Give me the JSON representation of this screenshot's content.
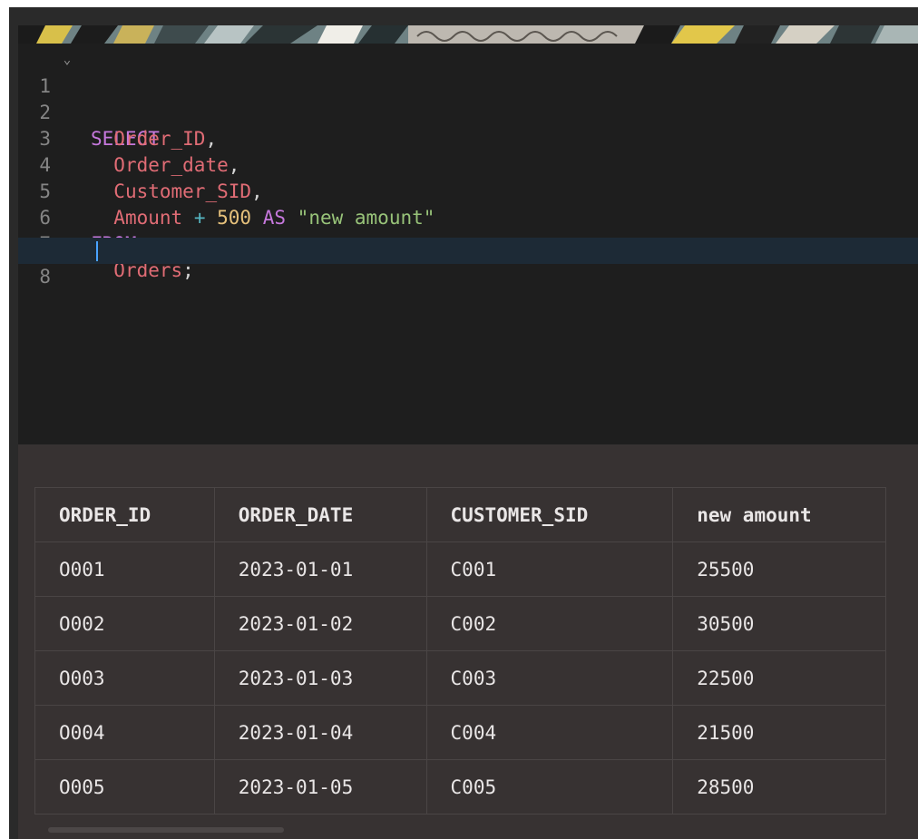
{
  "editor": {
    "line_numbers": [
      "1",
      "2",
      "3",
      "4",
      "5",
      "6",
      "7",
      "8"
    ],
    "fold_glyph": "⌄",
    "tokens": {
      "select": "SELECT",
      "order_id": "Order_ID",
      "order_date": "Order_date",
      "customer_sid": "Customer_SID",
      "amount": "Amount",
      "plus": "+",
      "five_hundred": "500",
      "as": "AS",
      "alias": "\"new amount\"",
      "from": "FROM",
      "orders": "Orders",
      "comma": ",",
      "semicolon": ";"
    }
  },
  "results": {
    "columns": [
      "ORDER_ID",
      "ORDER_DATE",
      "CUSTOMER_SID",
      "new amount"
    ],
    "rows": [
      [
        "O001",
        "2023-01-01",
        "C001",
        "25500"
      ],
      [
        "O002",
        "2023-01-02",
        "C002",
        "30500"
      ],
      [
        "O003",
        "2023-01-03",
        "C003",
        "22500"
      ],
      [
        "O004",
        "2023-01-04",
        "C004",
        "21500"
      ],
      [
        "O005",
        "2023-01-05",
        "C005",
        "28500"
      ]
    ]
  }
}
